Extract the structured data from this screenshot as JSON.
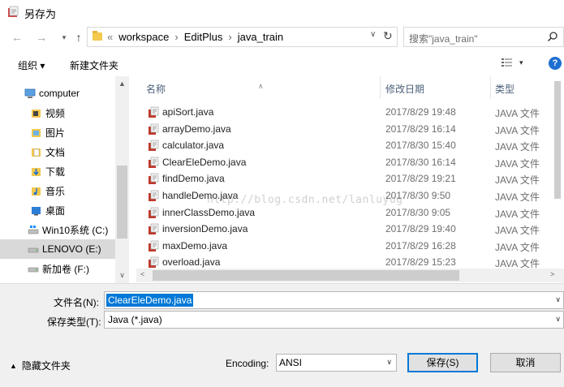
{
  "window": {
    "title": "另存为"
  },
  "nav": {
    "back_label": "←",
    "forward_label": "→",
    "up_label": "↑",
    "overflow_label": "«",
    "crumbs": [
      "workspace",
      "EditPlus",
      "java_train"
    ],
    "refresh_label": "↻",
    "search_placeholder": "搜索\"java_train\""
  },
  "toolbar": {
    "organize_label": "组织 ▾",
    "new_folder_label": "新建文件夹"
  },
  "tree": {
    "items": [
      {
        "label": "computer",
        "icon": "computer-icon"
      },
      {
        "label": "视频",
        "icon": "video-folder-icon"
      },
      {
        "label": "图片",
        "icon": "pictures-folder-icon"
      },
      {
        "label": "文档",
        "icon": "documents-folder-icon"
      },
      {
        "label": "下载",
        "icon": "downloads-folder-icon"
      },
      {
        "label": "音乐",
        "icon": "music-folder-icon"
      },
      {
        "label": "桌面",
        "icon": "desktop-folder-icon"
      },
      {
        "label": "Win10系统 (C:)",
        "icon": "windows-drive-icon"
      },
      {
        "label": "LENOVO (E:)",
        "icon": "drive-icon"
      },
      {
        "label": "新加卷 (F:)",
        "icon": "drive-icon"
      }
    ],
    "selected_index": 8
  },
  "file_list": {
    "columns": {
      "name": "名称",
      "modified": "修改日期",
      "type": "类型"
    },
    "rows": [
      {
        "name": "apiSort.java",
        "modified": "2017/8/29 19:48",
        "type": "JAVA 文件"
      },
      {
        "name": "arrayDemo.java",
        "modified": "2017/8/29 16:14",
        "type": "JAVA 文件"
      },
      {
        "name": "calculator.java",
        "modified": "2017/8/30 15:40",
        "type": "JAVA 文件"
      },
      {
        "name": "ClearEleDemo.java",
        "modified": "2017/8/30 16:14",
        "type": "JAVA 文件"
      },
      {
        "name": "findDemo.java",
        "modified": "2017/8/29 19:21",
        "type": "JAVA 文件"
      },
      {
        "name": "handleDemo.java",
        "modified": "2017/8/30 9:50",
        "type": "JAVA 文件"
      },
      {
        "name": "innerClassDemo.java",
        "modified": "2017/8/30 9:05",
        "type": "JAVA 文件"
      },
      {
        "name": "inversionDemo.java",
        "modified": "2017/8/29 19:40",
        "type": "JAVA 文件"
      },
      {
        "name": "maxDemo.java",
        "modified": "2017/8/29 16:28",
        "type": "JAVA 文件"
      },
      {
        "name": "overload.java",
        "modified": "2017/8/29 15:23",
        "type": "JAVA 文件"
      }
    ]
  },
  "watermark": "http://blog.csdn.net/lanluyug",
  "form": {
    "filename_label": "文件名(N):",
    "filename_value": "ClearEleDemo.java",
    "filetype_label": "保存类型(T):",
    "filetype_value": "Java (*.java)",
    "hide_folders_label": "隐藏文件夹",
    "encoding_label": "Encoding:",
    "encoding_value": "ANSI",
    "save_label": "保存(S)",
    "cancel_label": "取消"
  },
  "colors": {
    "accent": "#0078d7",
    "selection_bg": "#d9d9d9",
    "header_text": "#4c607a",
    "java_icon": "#c0392b"
  }
}
